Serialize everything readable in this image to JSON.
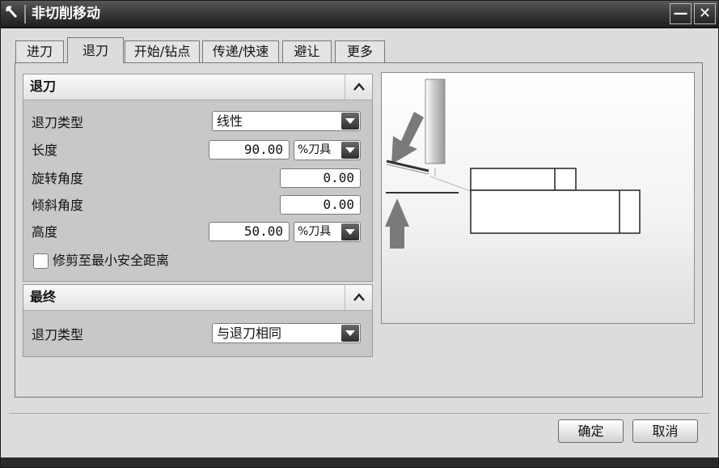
{
  "window": {
    "title": "非切削移动",
    "title_icon": "tool-icon",
    "minimize_label": "—",
    "close_label": "✕"
  },
  "tabs": [
    {
      "label": "进刀",
      "active": false
    },
    {
      "label": "退刀",
      "active": true
    },
    {
      "label": "开始/钻点",
      "active": false
    },
    {
      "label": "传递/快速",
      "active": false
    },
    {
      "label": "避让",
      "active": false
    },
    {
      "label": "更多",
      "active": false
    }
  ],
  "retract": {
    "title": "退刀",
    "collapse_icon": "chevron-up-icon",
    "type_label": "退刀类型",
    "type_value": "线性",
    "length_label": "长度",
    "length_value": "90.00",
    "length_unit": "%刀具",
    "rotation_label": "旋转角度",
    "rotation_value": "0.00",
    "tilt_label": "倾斜角度",
    "tilt_value": "0.00",
    "height_label": "高度",
    "height_value": "50.00",
    "height_unit": "%刀具",
    "trim_label": "修剪至最小安全距离",
    "trim_checked": false
  },
  "final": {
    "title": "最终",
    "collapse_icon": "chevron-up-icon",
    "type_label": "退刀类型",
    "type_value": "与退刀相同"
  },
  "buttons": {
    "ok": "确定",
    "cancel": "取消"
  },
  "colors": {
    "titlebar": "#2a2a2a",
    "arrow_fill": "#7a7a7a",
    "panel_bg": "#dcdcdc"
  }
}
